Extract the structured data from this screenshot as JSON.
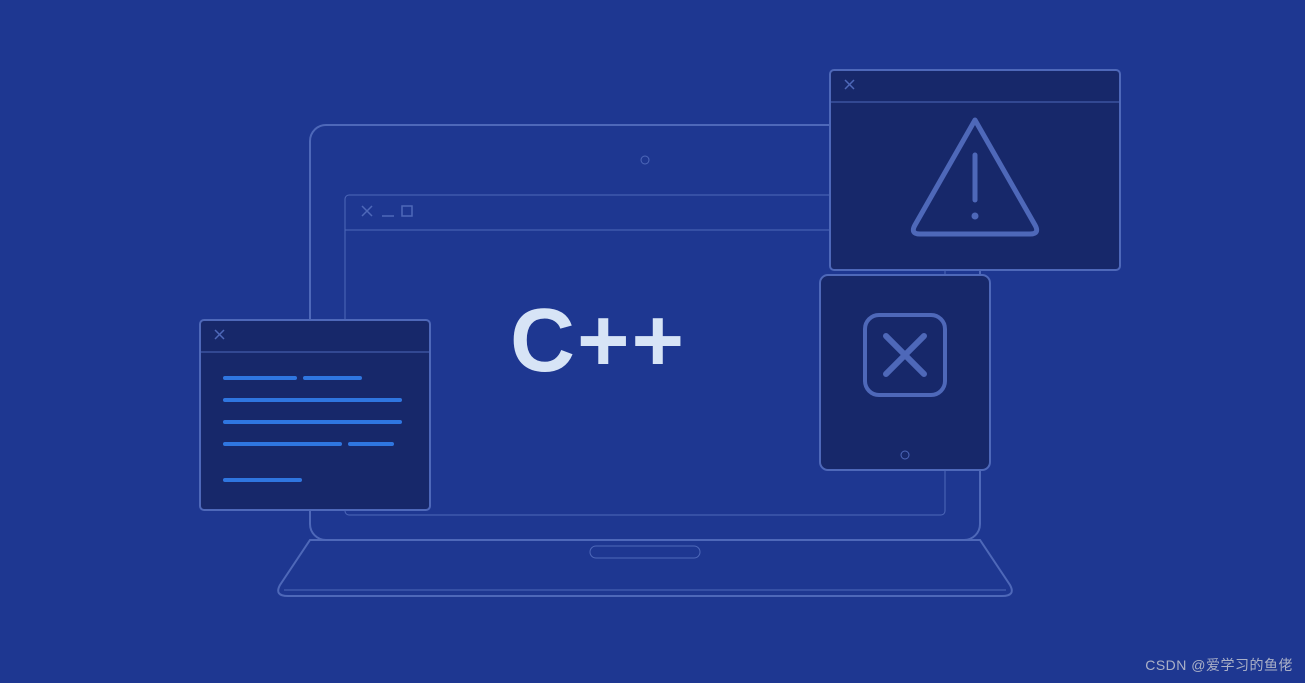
{
  "logo": {
    "text": "C++"
  },
  "watermark": {
    "text": "CSDN @爱学习的鱼佬"
  },
  "colors": {
    "background": "#1e3791",
    "outline": "#4e68b9",
    "dark_panel": "#17286a",
    "accent_blue": "#2f76e0",
    "logo_text": "#d7e4f6"
  },
  "icons": {
    "warning": "warning-triangle-icon",
    "close_x": "x-mark-icon",
    "window_close": "close-icon",
    "window_minimize": "minimize-icon",
    "window_maximize": "maximize-icon",
    "camera_dot": "camera-icon",
    "tablet_home": "home-button-icon"
  }
}
